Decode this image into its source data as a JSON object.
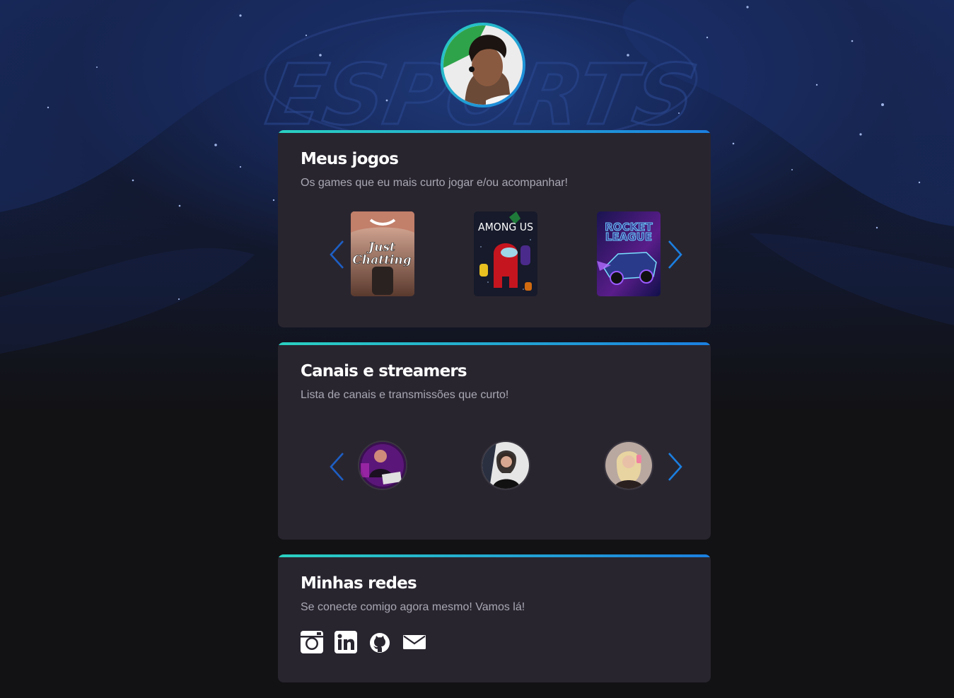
{
  "sections": {
    "games": {
      "title": "Meus jogos",
      "subtitle": "Os games que eu mais curto jogar e/ou acompanhar!",
      "items": [
        {
          "name": "Just Chatting",
          "line1": "Just",
          "line2": "Chatting"
        },
        {
          "name": "Among Us",
          "label": "AMONG US"
        },
        {
          "name": "Rocket League",
          "line1": "ROCKET",
          "line2": "LEAGUE"
        }
      ]
    },
    "channels": {
      "title": "Canais e streamers",
      "subtitle": "Lista de canais e transmissões que curto!"
    },
    "socials": {
      "title": "Minhas redes",
      "subtitle": "Se conecte comigo agora mesmo! Vamos lá!",
      "links": [
        "instagram",
        "linkedin",
        "github",
        "email"
      ]
    }
  },
  "background_watermark": "ESPORTS",
  "colors": {
    "accent_start": "#2ad1c1",
    "accent_end": "#1b7fe0",
    "card_bg": "#29252f",
    "subtitle": "#a8a8b3"
  }
}
